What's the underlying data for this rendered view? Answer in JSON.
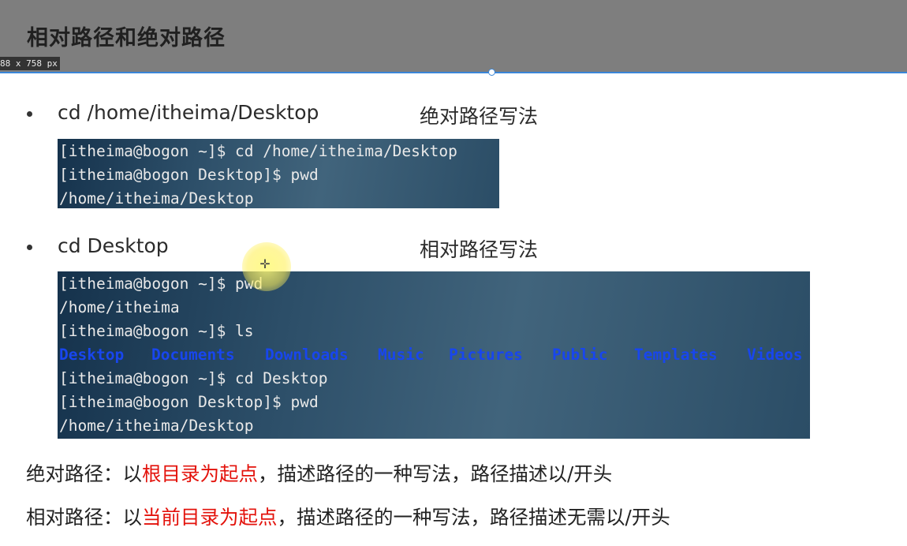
{
  "header": {
    "title": "相对路径和绝对路径",
    "dimension_label": "88 x 758  px"
  },
  "section1": {
    "command": "cd /home/itheima/Desktop",
    "description": "绝对路径写法",
    "terminal_lines": [
      "[itheima@bogon ~]$ cd /home/itheima/Desktop",
      "[itheima@bogon Desktop]$ pwd",
      "/home/itheima/Desktop"
    ]
  },
  "section2": {
    "command": "cd Desktop",
    "description": "相对路径写法",
    "terminal_lines_before": [
      "[itheima@bogon ~]$ pwd",
      "/home/itheima",
      "[itheima@bogon ~]$ ls"
    ],
    "ls_output": [
      "Desktop",
      "Documents",
      "Downloads",
      "Music",
      "Pictures",
      "Public",
      "Templates",
      "Videos"
    ],
    "terminal_lines_after": [
      "[itheima@bogon ~]$ cd Desktop",
      "[itheima@bogon Desktop]$ pwd",
      "/home/itheima/Desktop"
    ]
  },
  "definitions": {
    "absolute": {
      "prefix": "绝对路径：以",
      "highlight": "根目录为起点",
      "suffix": "，描述路径的一种写法，路径描述以/开头"
    },
    "relative": {
      "prefix": "相对路径：以",
      "highlight": "当前目录为起点",
      "suffix": "，描述路径的一种写法，路径描述无需以/开头"
    }
  },
  "colors": {
    "header_bg": "#7e7e7e",
    "accent_line": "#3a86d8",
    "terminal_text": "#e9e9e9",
    "directory_blue": "#1846ee",
    "emphasis_red": "#e3120b"
  },
  "icons": {
    "cursor": "crosshair-cursor-icon"
  }
}
